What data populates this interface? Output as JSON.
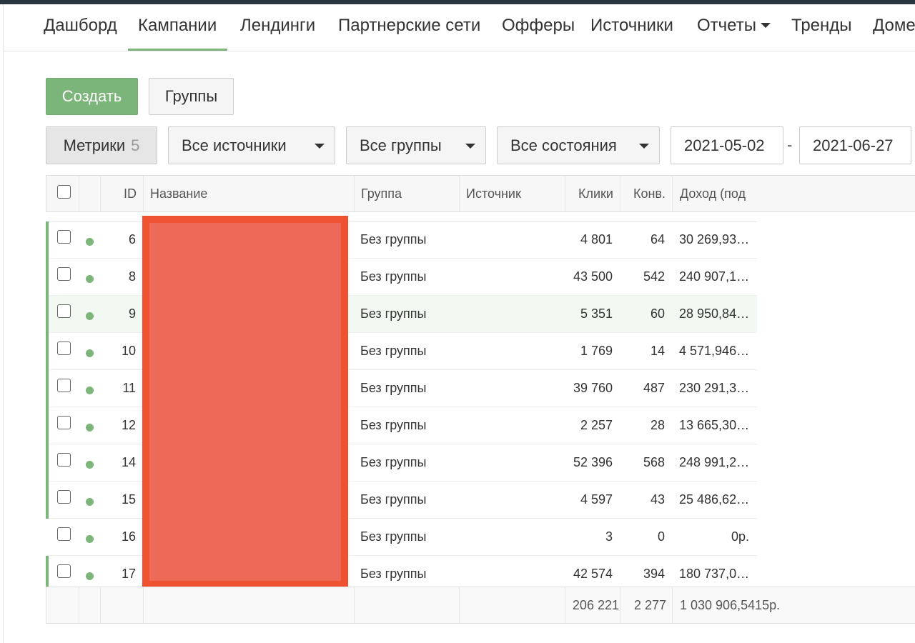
{
  "nav": {
    "items": [
      {
        "label": "Дашборд"
      },
      {
        "label": "Кампании",
        "active": true
      },
      {
        "label": "Лендинги"
      },
      {
        "label": "Партнерские сети"
      },
      {
        "label": "Офферы"
      },
      {
        "label": "Источники"
      },
      {
        "label": "Отчеты"
      },
      {
        "label": "Тренды"
      },
      {
        "label": "Доме"
      }
    ]
  },
  "toolbar": {
    "create_label": "Создать",
    "groups_label": "Группы",
    "metrics_label": "Метрики",
    "metrics_count": "5",
    "sources_select": "Все источники",
    "groups_select": "Все группы",
    "states_select": "Все состояния",
    "date_from": "2021-05-02",
    "date_separator": "-",
    "date_to": "2021-06-27"
  },
  "table": {
    "headers": {
      "id": "ID",
      "name": "Название",
      "group": "Группа",
      "source": "Источник",
      "clicks": "Клики",
      "conversions": "Конв.",
      "revenue": "Доход (под"
    },
    "rows": [
      {
        "id": "6",
        "group": "Без группы",
        "source": "",
        "clicks": "4 801",
        "conversions": "64",
        "revenue": "30 269,93…"
      },
      {
        "id": "8",
        "group": "Без группы",
        "source": "",
        "clicks": "43 500",
        "conversions": "542",
        "revenue": "240 907,1…"
      },
      {
        "id": "9",
        "group": "Без группы",
        "source": "",
        "clicks": "5 351",
        "conversions": "60",
        "revenue": "28 950,84…"
      },
      {
        "id": "10",
        "group": "Без группы",
        "source": "",
        "clicks": "1 769",
        "conversions": "14",
        "revenue": "4 571,946…"
      },
      {
        "id": "11",
        "group": "Без группы",
        "source": "",
        "clicks": "39 760",
        "conversions": "487",
        "revenue": "230 291,3…"
      },
      {
        "id": "12",
        "group": "Без группы",
        "source": "",
        "clicks": "2 257",
        "conversions": "28",
        "revenue": "13 665,30…"
      },
      {
        "id": "14",
        "group": "Без группы",
        "source": "",
        "clicks": "52 396",
        "conversions": "568",
        "revenue": "248 991,2…"
      },
      {
        "id": "15",
        "group": "Без группы",
        "source": "",
        "clicks": "4 597",
        "conversions": "43",
        "revenue": "25 486,62…"
      },
      {
        "id": "16",
        "group": "Без группы",
        "source": "",
        "clicks": "3",
        "conversions": "0",
        "revenue": "0р."
      },
      {
        "id": "17",
        "group": "Без группы",
        "source": "",
        "clicks": "42 574",
        "conversions": "394",
        "revenue": "180 737,0…"
      }
    ],
    "totals": {
      "clicks": "206 221",
      "conversions": "2 277",
      "revenue": "1 030 906,5415р."
    }
  },
  "colors": {
    "accent": "#7bb57a",
    "topbar": "#2b3540",
    "redaction_fill": "#ec6a57",
    "redaction_border": "#ee5230",
    "row_highlight": "#f2f9f3"
  }
}
